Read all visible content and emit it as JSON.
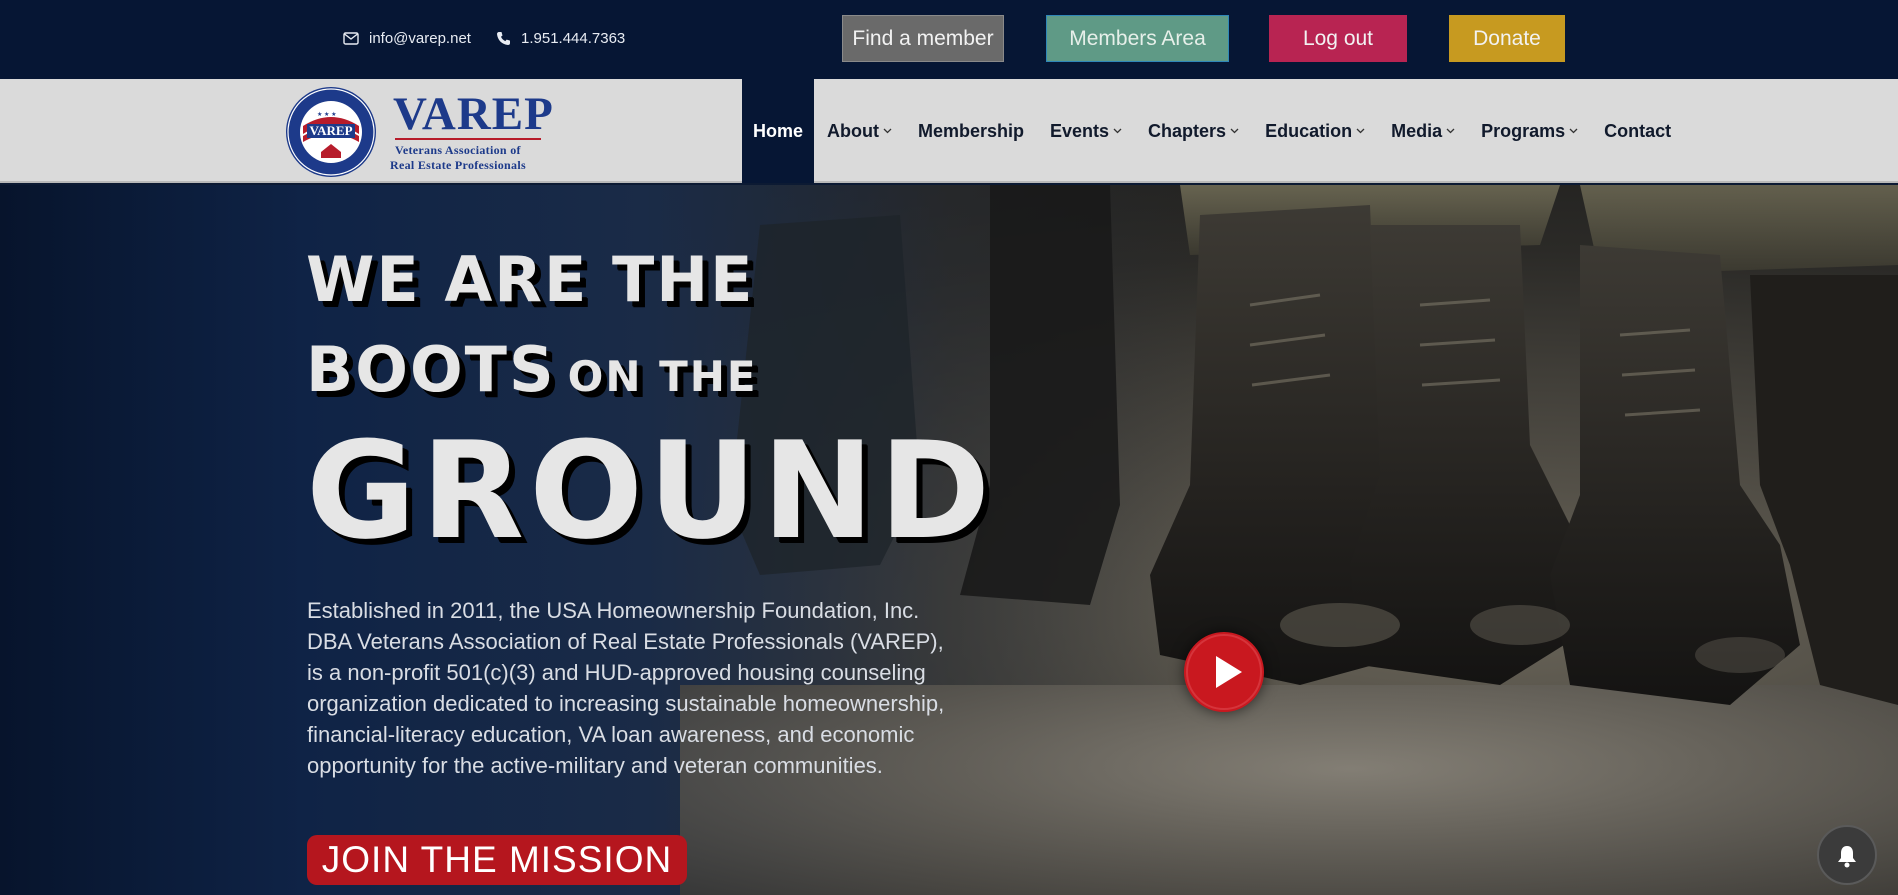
{
  "topbar": {
    "email": "info@varep.net",
    "phone": "1.951.444.7363",
    "buttons": {
      "find": "Find a member",
      "members": "Members Area",
      "logout": "Log out",
      "donate": "Donate"
    }
  },
  "logo": {
    "wordmark": "VAREP",
    "sub1": "Veterans Association of",
    "sub2": "Real Estate Professionals",
    "seal_top": "VETERANS ASSOCIATION",
    "seal_bottom": "OF REAL ESTATE PROFESSIONALS",
    "seal_center": "VAREP"
  },
  "nav": {
    "items": [
      {
        "label": "Home",
        "active": true
      },
      {
        "label": "About",
        "dropdown": true
      },
      {
        "label": "Membership"
      },
      {
        "label": "Events",
        "dropdown": true
      },
      {
        "label": "Chapters",
        "dropdown": true
      },
      {
        "label": "Education",
        "dropdown": true
      },
      {
        "label": "Media",
        "dropdown": true
      },
      {
        "label": "Programs",
        "dropdown": true
      },
      {
        "label": "Contact"
      }
    ]
  },
  "hero": {
    "line1": "WE ARE THE",
    "line2_big": "BOOTS",
    "line2_small": "ON THE",
    "line3": "GROUND",
    "description": "Established in 2011, the USA Homeownership Foundation, Inc. DBA Veterans Association of Real Estate Professionals (VAREP), is a non-profit 501(c)(3) and HUD-approved housing counseling organization dedicated to increasing sustainable homeownership, financial-literacy education, VA loan awareness, and economic opportunity for the active-military and veteran communities.",
    "cta": "JOIN THE MISSION"
  },
  "icons": {
    "email": "envelope-icon",
    "phone": "phone-icon",
    "play": "play-icon",
    "bell": "bell-icon",
    "chevron": "chevron-down-icon"
  },
  "colors": {
    "navy": "#061634",
    "find": "#6a6a6a",
    "members": "#5f9a86",
    "logout": "#b82452",
    "donate": "#c79a20",
    "cta": "#b5161e"
  }
}
